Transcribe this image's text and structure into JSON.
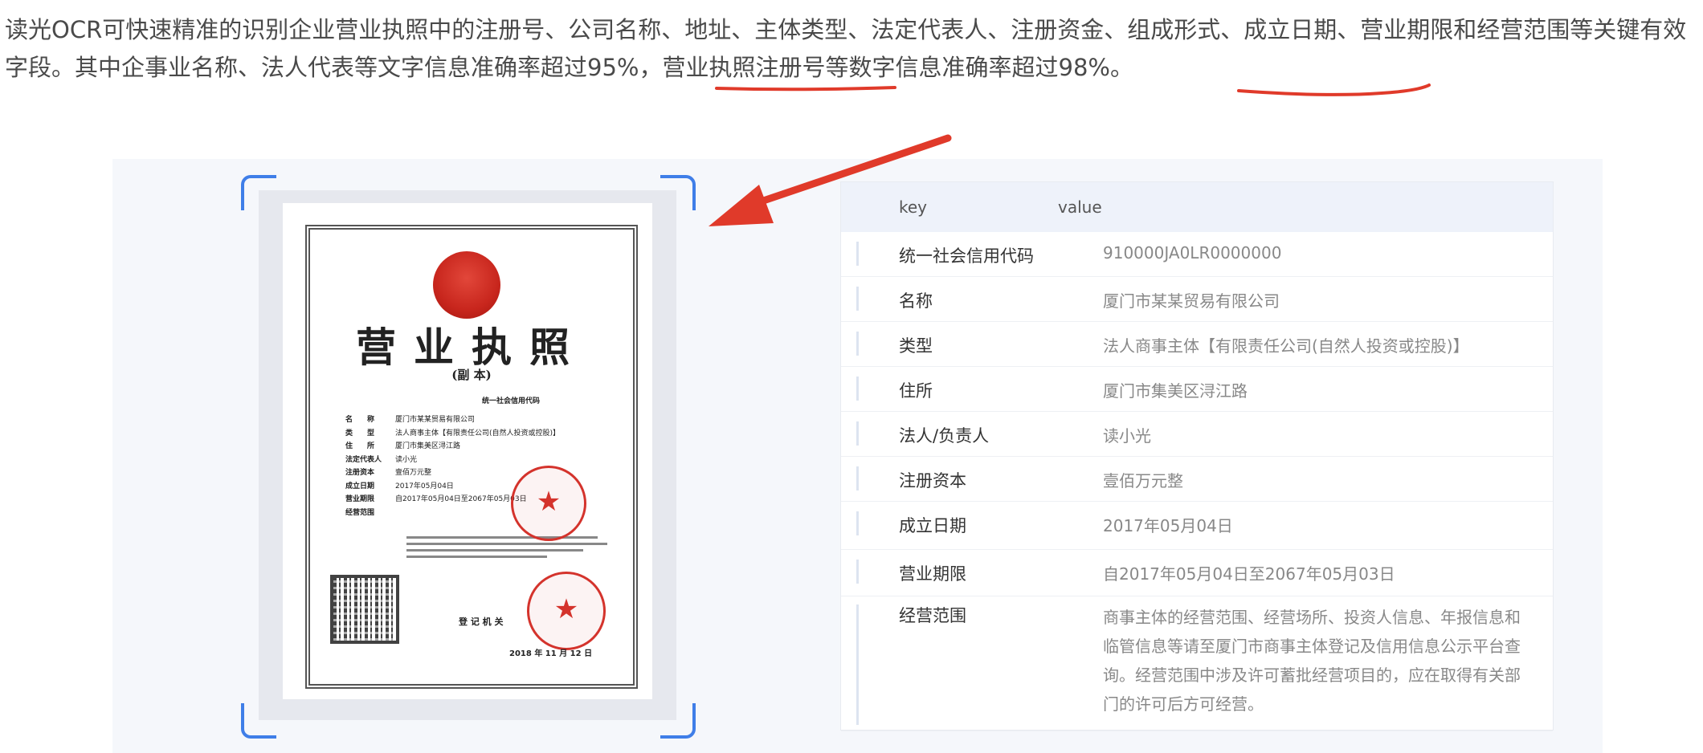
{
  "intro": {
    "part1": "读光OCR可快速精准的识别企业营业执照中的注册号、公司名称、地址、主体类型、法定代表人、注册资金、组成形式、成立日期、营业期限和经营范围等关键有效字段。其中企事业名称、法人代表等文字信息",
    "hl1": "准确率超过95%",
    "part2": "，营业执照注册号等数字信息",
    "hl2": "准确率超过98%。"
  },
  "license": {
    "title": "营业执照",
    "subtitle": "(副 本)",
    "code_label": "统一社会信用代码",
    "fields": [
      {
        "k": "名　　称",
        "v": "厦门市某某贸易有限公司"
      },
      {
        "k": "类　　型",
        "v": "法人商事主体【有限责任公司(自然人投资或控股)】"
      },
      {
        "k": "住　　所",
        "v": "厦门市集美区浔江路"
      },
      {
        "k": "法定代表人",
        "v": "读小光"
      },
      {
        "k": "注册资本",
        "v": "壹佰万元整"
      },
      {
        "k": "成立日期",
        "v": "2017年05月04日"
      },
      {
        "k": "营业期限",
        "v": "自2017年05月04日至2067年05月03日"
      },
      {
        "k": "经营范围",
        "v": ""
      }
    ],
    "authority": "登 记 机 关",
    "date": "2018 年 11 月 12 日"
  },
  "table": {
    "header_key": "key",
    "header_value": "value",
    "rows": [
      {
        "key": "统一社会信用代码",
        "value": "910000JA0LR0000000"
      },
      {
        "key": "名称",
        "value": "厦门市某某贸易有限公司"
      },
      {
        "key": "类型",
        "value": "法人商事主体【有限责任公司(自然人投资或控股)】"
      },
      {
        "key": "住所",
        "value": "厦门市集美区浔江路"
      },
      {
        "key": "法人/负责人",
        "value": "读小光"
      },
      {
        "key": "注册资本",
        "value": "壹佰万元整"
      },
      {
        "key": "成立日期",
        "value": "2017年05月04日"
      },
      {
        "key": "营业期限",
        "value": "自2017年05月04日至2067年05月03日"
      },
      {
        "key": "经营范围",
        "value": "商事主体的经营范围、经营场所、投资人信息、年报信息和临管信息等请至厦门市商事主体登记及信用信息公示平台查询。经营范围中涉及许可蓄批经营项目的，应在取得有关部门的许可后方可经营。"
      }
    ]
  },
  "colors": {
    "accent": "#3f7ee8",
    "annotation": "#e03a2a",
    "seal": "#d4332c"
  }
}
